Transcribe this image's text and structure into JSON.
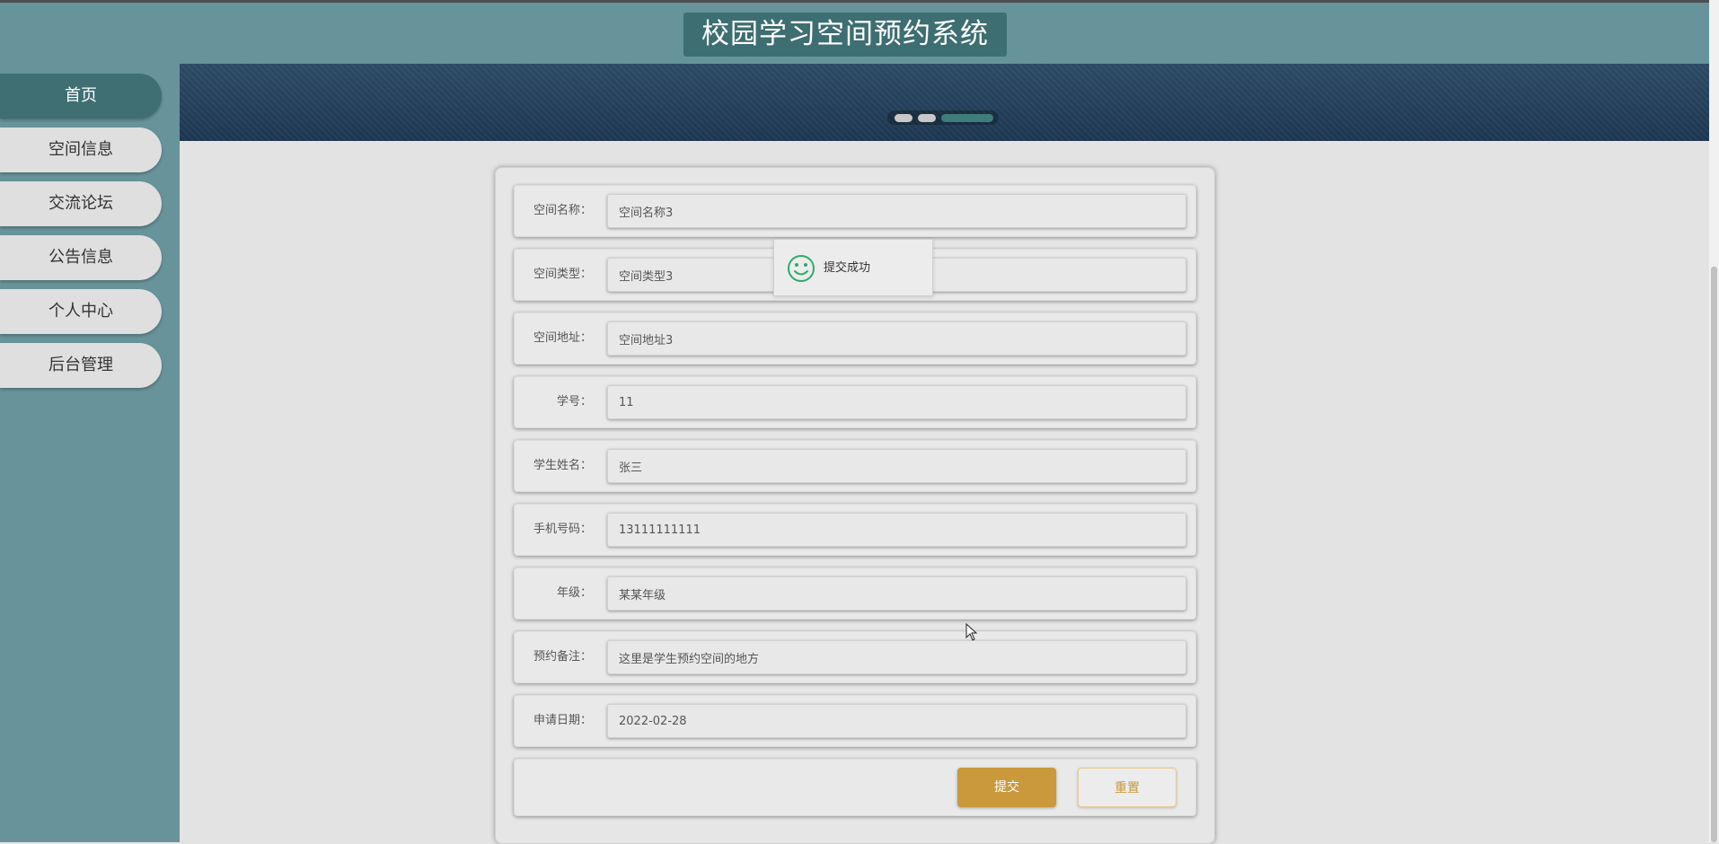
{
  "header": {
    "title": "校园学习空间预约系统"
  },
  "sidebar": {
    "items": [
      {
        "label": "首页",
        "active": true
      },
      {
        "label": "空间信息",
        "active": false
      },
      {
        "label": "交流论坛",
        "active": false
      },
      {
        "label": "公告信息",
        "active": false
      },
      {
        "label": "个人中心",
        "active": false
      },
      {
        "label": "后台管理",
        "active": false
      }
    ]
  },
  "carousel": {
    "slide_count": 3,
    "active_index": 2
  },
  "form": {
    "fields": [
      {
        "label": "空间名称：",
        "value": "空间名称3"
      },
      {
        "label": "空间类型：",
        "value": "空间类型3"
      },
      {
        "label": "空间地址：",
        "value": "空间地址3"
      },
      {
        "label": "学号：",
        "value": "11"
      },
      {
        "label": "学生姓名：",
        "value": "张三"
      },
      {
        "label": "手机号码：",
        "value": "13111111111"
      },
      {
        "label": "年级：",
        "value": "某某年级"
      },
      {
        "label": "预约备注：",
        "value": "这里是学生预约空间的地方"
      },
      {
        "label": "申请日期：",
        "value": "2022-02-28"
      }
    ],
    "submit_label": "提交",
    "reset_label": "重置"
  },
  "toast": {
    "message": "提交成功",
    "icon": "smile-icon"
  },
  "colors": {
    "header_bg": "#67949a",
    "title_bg": "#3d6e71",
    "nav_active": "#3f6f73",
    "submit_bg": "#c9993c",
    "toast_icon": "#2eab6a"
  }
}
